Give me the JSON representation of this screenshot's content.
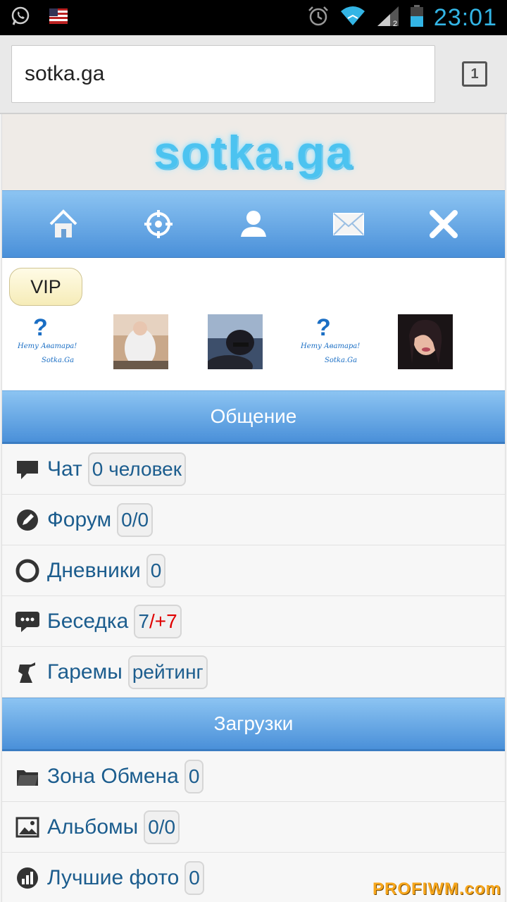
{
  "status_bar": {
    "time": "23:01",
    "icons": [
      "whatsapp-icon",
      "us-flag-icon",
      "alarm-icon",
      "wifi-icon",
      "signal-icon",
      "battery-icon"
    ]
  },
  "browser": {
    "url": "sotka.ga",
    "tab_count": "1"
  },
  "site": {
    "logo": "sotka.ga"
  },
  "nav": [
    "home-icon",
    "target-icon",
    "user-icon",
    "mail-icon",
    "close-icon"
  ],
  "vip": {
    "label": "VIP"
  },
  "avatars": {
    "no_avatar_line1": "Нету Аватара!",
    "no_avatar_line2": "Sotka.Ga",
    "no_avatar_mark": "?"
  },
  "sections": [
    {
      "title": "Общение",
      "items": [
        {
          "label": "Чат",
          "badge": "0 человек",
          "icon": "chat-bubble-icon"
        },
        {
          "label": "Форум",
          "badge": "0/0",
          "icon": "forum-pencil-icon"
        },
        {
          "label": "Дневники",
          "badge": "0",
          "icon": "diary-ring-icon"
        },
        {
          "label": "Беседка",
          "badge_main": "7",
          "badge_extra": "/+7",
          "icon": "speech-dots-icon"
        },
        {
          "label": "Гаремы",
          "badge": "рейтинг",
          "icon": "harem-figure-icon"
        }
      ]
    },
    {
      "title": "Загрузки",
      "items": [
        {
          "label": "Зона Обмена",
          "badge": "0",
          "icon": "folder-icon"
        },
        {
          "label": "Альбомы",
          "badge": "0/0",
          "icon": "image-icon"
        },
        {
          "label": "Лучшие фото",
          "badge": "0",
          "icon": "bar-chart-icon"
        }
      ]
    }
  ],
  "colors": {
    "accent": "#4a90d9",
    "link": "#1c5d8e",
    "status": "#33b5e5",
    "highlight": "#e00000"
  },
  "watermark": "PROFIWM.com"
}
